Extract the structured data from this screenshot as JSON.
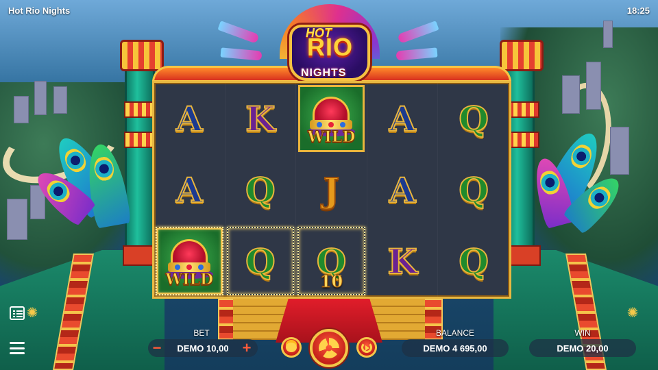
{
  "game": {
    "title": "Hot Rio Nights",
    "clock": "18:25"
  },
  "logo": {
    "hot": "HOT",
    "rio": "RIO",
    "nights": "NIGHTS"
  },
  "reels": {
    "grid": [
      [
        "A",
        "K",
        "WILD",
        "A",
        "Q"
      ],
      [
        "A",
        "Q",
        "J",
        "A",
        "Q"
      ],
      [
        "WILD",
        "Q",
        "Q",
        "K",
        "Q"
      ]
    ],
    "wild_label": "WILD",
    "winning_cells": [
      [
        2,
        0
      ],
      [
        2,
        1
      ],
      [
        2,
        2
      ]
    ],
    "win_value": "10"
  },
  "controls": {
    "bet_label": "BET",
    "bet_value": "DEMO 10,00",
    "minus": "−",
    "plus": "+",
    "balance_label": "BALANCE",
    "balance_value": "DEMO 4 695,00",
    "win_label": "WIN",
    "win_value": "DEMO 20,00"
  },
  "icons": {
    "paytable": "paytable-icon",
    "menu": "menu-icon",
    "spin": "spin-icon",
    "coins": "coins-icon",
    "autoplay": "autoplay-icon"
  },
  "colors": {
    "frame_gold": "#e8b842",
    "reel_bg": "#2f3747",
    "spin_red": "#c4201a",
    "accent_plus_minus": "#ff5a3a"
  }
}
